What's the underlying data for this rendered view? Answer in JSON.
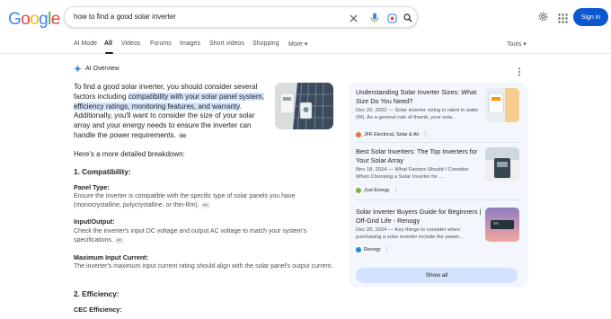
{
  "header": {
    "logo": "Google",
    "query": "how to find a good solar inverter",
    "sign_in": "Sign in"
  },
  "tabs": [
    "AI Mode",
    "All",
    "Videos",
    "Forums",
    "Images",
    "Short videos",
    "Shopping",
    "More ▾"
  ],
  "tools": "Tools ▾",
  "ai_overview": {
    "label": "AI Overview",
    "intro_before": "To find a good solar inverter, you should consider several factors including ",
    "intro_highlight": "compatibility with your solar panel system, efficiency ratings, monitoring features, and warranty",
    "intro_after": ". Additionally, you'll want to consider the size of your solar array and your energy needs to ensure the inverter can handle the power requirements.",
    "breakdown_intro": "Here's a more detailed breakdown:",
    "section1": "1. Compatibility:",
    "panel_type_label": "Panel Type:",
    "panel_type_text": "Ensure the inverter is compatible with the specific type of solar panels you have (monocrystalline, polycrystalline, or thin-film).",
    "io_label": "Input/Output:",
    "io_text": "Check the inverter's input DC voltage and output AC voltage to match your system's specifications.",
    "max_label": "Maximum Input Current:",
    "max_text": "The inverter's maximum input current rating should align with the solar panel's output current.",
    "section2": "2. Efficiency:",
    "cec_label": "CEC Efficiency:"
  },
  "sources": [
    {
      "title": "Understanding Solar Inverter Sizes: What Size Do You Need?",
      "snippet": "Dec 20, 2022 — Solar inverter sizing is rated in watts (W). As a general rule of thumb, your sola...",
      "site": "JFK Electrical, Solar & Air",
      "fav_color": "#e8743b"
    },
    {
      "title": "Best Solar Inverters: The Top Inverters for Your Solar Array",
      "snippet": "Nov 18, 2024 — What Factors Should I Consider When Choosing a Solar Inverter for ...",
      "site": "Just Energy",
      "fav_color": "#7cb342"
    },
    {
      "title": "Solar Inverter Buyers Guide for Beginners | Off-Grid Life - Renogy",
      "snippet": "Dec 20, 2024 — Key things to consider when purchasing a solar inverter include the power...",
      "site": "Renogy",
      "fav_color": "#1e88e5"
    }
  ],
  "show_all": "Show all",
  "colors": {
    "accent": "#0b57d0",
    "highlight": "#d3e3fd",
    "panel": "#f3f6fc"
  }
}
